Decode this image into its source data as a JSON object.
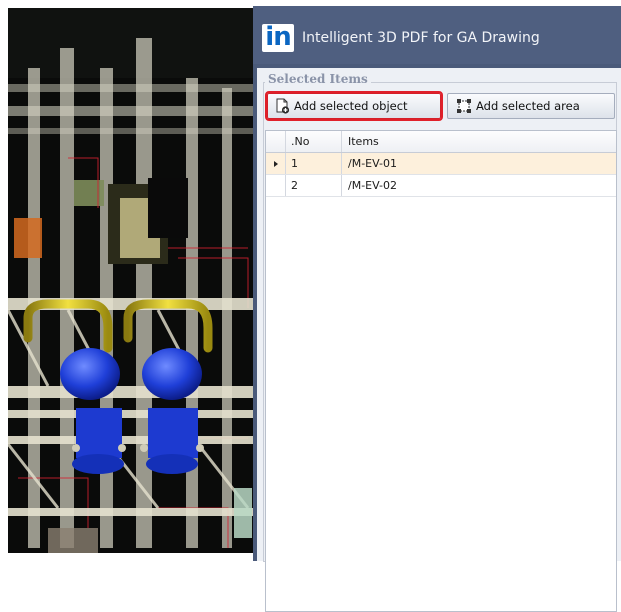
{
  "panel": {
    "logo_text": "in",
    "title": "Intelligent 3D PDF for GA Drawing",
    "group_label": "Selected Items",
    "buttons": {
      "add_object": "Add selected object",
      "add_area": "Add selected area"
    },
    "grid": {
      "columns": [
        ".No",
        "Items"
      ],
      "rows": [
        {
          "no": "1",
          "item": "/M-EV-01",
          "current": true
        },
        {
          "no": "2",
          "item": "/M-EV-02",
          "current": false
        }
      ]
    }
  },
  "colors": {
    "panel_header": "#4f5f80",
    "highlight": "#e0202a",
    "row_selected": "#fdf0dc",
    "logo_blue": "#0a66c2"
  },
  "icons": [
    "add-document-icon",
    "select-area-icon",
    "row-pointer-icon"
  ]
}
